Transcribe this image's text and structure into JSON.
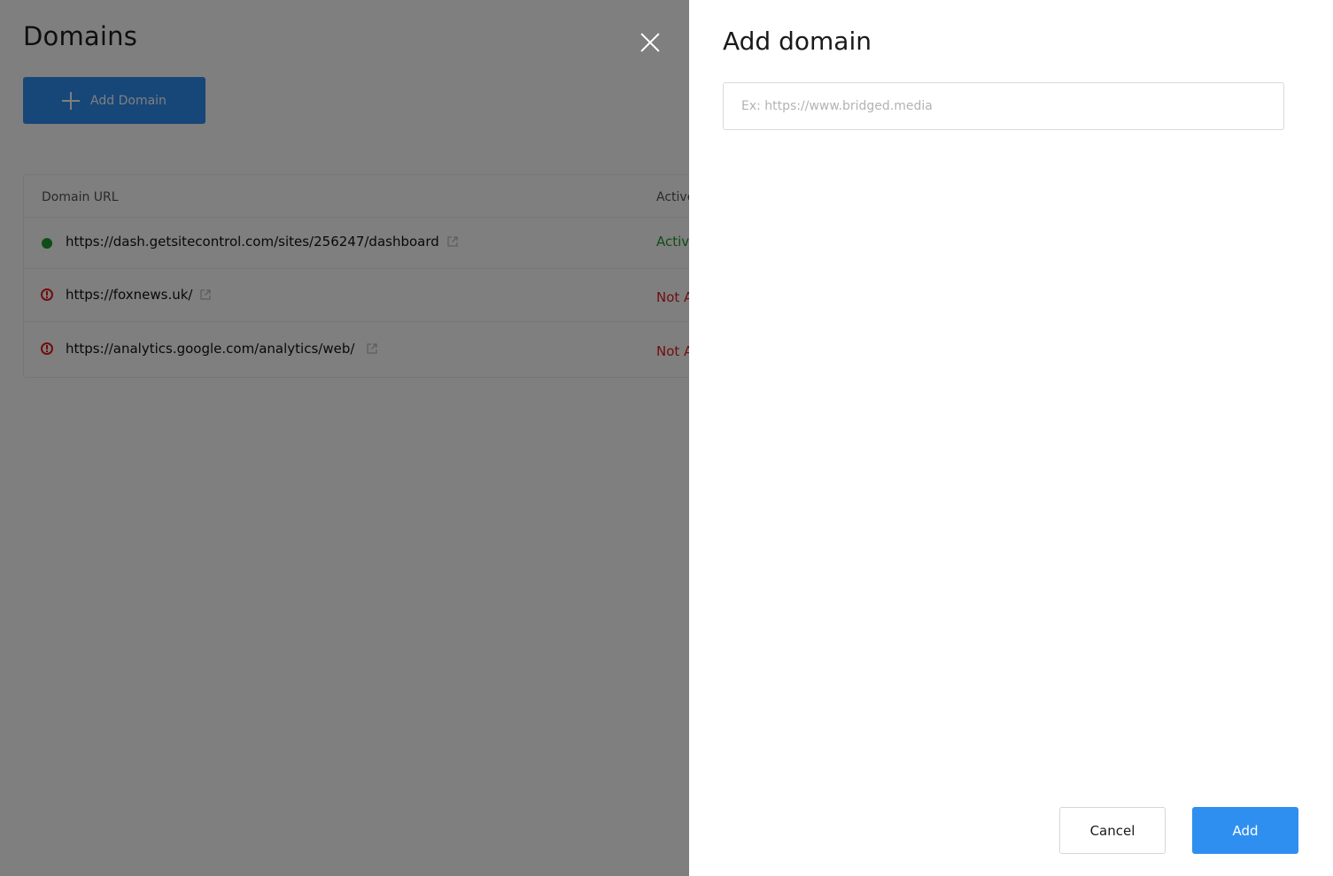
{
  "page": {
    "title": "Domains",
    "add_button_label": "Add Domain"
  },
  "table": {
    "headers": {
      "url": "Domain URL",
      "status": "Active"
    },
    "rows": [
      {
        "url": "https://dash.getsitecontrol.com/sites/256247/dashboard",
        "status": "Active",
        "state": "active"
      },
      {
        "url": "https://foxnews.uk/",
        "status": "Not A",
        "state": "inactive"
      },
      {
        "url": "https://analytics.google.com/analytics/web/",
        "status": "Not A",
        "state": "inactive"
      }
    ]
  },
  "drawer": {
    "title": "Add domain",
    "input_placeholder": "Ex: https://www.bridged.media",
    "input_value": "",
    "cancel_label": "Cancel",
    "add_label": "Add"
  },
  "colors": {
    "primary": "#2f8ff0",
    "success": "#1e9b2f",
    "danger": "#e11d1d",
    "overlay": "rgba(0,0,0,0.5)"
  },
  "icons": {
    "add_button": "plus-icon",
    "status_active": "green-dot-icon",
    "status_inactive": "alert-circle-icon",
    "external": "external-link-icon",
    "close": "close-icon"
  }
}
